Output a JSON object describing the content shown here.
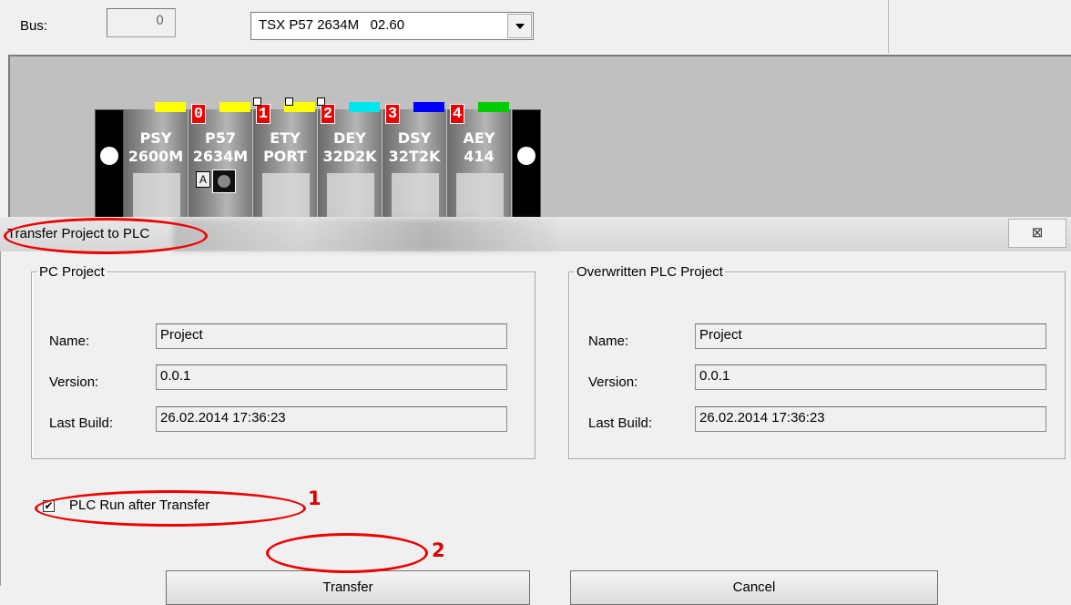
{
  "top": {
    "bus_label": "Bus:",
    "bus_value": "0",
    "cpu_select_value": "TSX P57 2634M   02.60"
  },
  "rack": {
    "modules": [
      {
        "slot": "",
        "line1": "PSY",
        "line2": "2600M",
        "stripe": "#ffff00"
      },
      {
        "slot": "0",
        "line1": "P57",
        "line2": "2634M",
        "stripe": "#ffff00"
      },
      {
        "slot": "1",
        "line1": "ETY",
        "line2": "PORT",
        "stripe": "#ffff00"
      },
      {
        "slot": "2",
        "line1": "DEY",
        "line2": "32D2K",
        "stripe": "#00e5ee"
      },
      {
        "slot": "3",
        "line1": "DSY",
        "line2": "32T2K",
        "stripe": "#0000ff"
      },
      {
        "slot": "4",
        "line1": "AEY",
        "line2": "414",
        "stripe": "#00cc00"
      }
    ]
  },
  "dialog": {
    "title": "Transfer Project to PLC",
    "close_glyph": "⊠",
    "pc_group": {
      "legend": "PC Project",
      "name_label": "Name:",
      "name_value": "Project",
      "version_label": "Version:",
      "version_value": "0.0.1",
      "build_label": "Last Build:",
      "build_value": "26.02.2014 17:36:23"
    },
    "plc_group": {
      "legend": "Overwritten PLC Project",
      "name_label": "Name:",
      "name_value": "Project",
      "version_label": "Version:",
      "version_value": "0.0.1",
      "build_label": "Last Build:",
      "build_value": "26.02.2014 17:36:23"
    },
    "checkbox_label": "PLC Run after Transfer",
    "checkbox_checked": true,
    "check_glyph": "✔",
    "transfer_button": "Transfer",
    "cancel_button": "Cancel"
  },
  "annotations": {
    "marker1": "1",
    "marker2": "2",
    "color": "#e00000"
  }
}
